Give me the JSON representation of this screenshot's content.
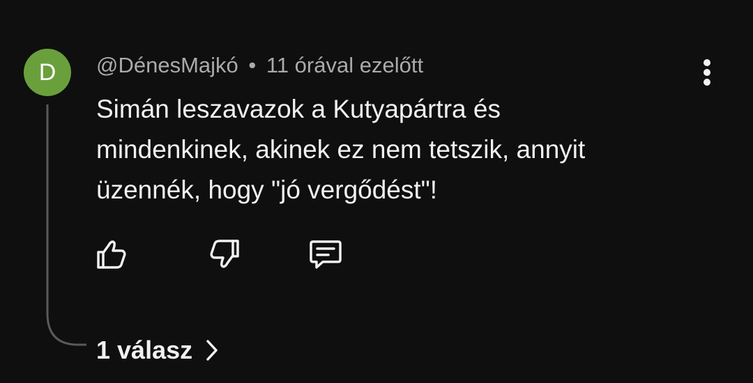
{
  "comment": {
    "avatar_letter": "D",
    "avatar_color": "#6aa03c",
    "author": "@DénesMajkó",
    "separator": "•",
    "time": "11 órával ezelőtt",
    "text_lines": [
      "Simán leszavazok a Kutyapártra és",
      "mindenkinek, akinek ez nem tetszik, annyit",
      "üzennék, hogy \"jó vergődést\"!"
    ],
    "replies_label": "1 válasz"
  },
  "icons": {
    "menu": "more-vert-icon",
    "like": "thumb-up-icon",
    "dislike": "thumb-down-icon",
    "reply": "comment-icon",
    "replies_chevron": "chevron-right-icon"
  }
}
